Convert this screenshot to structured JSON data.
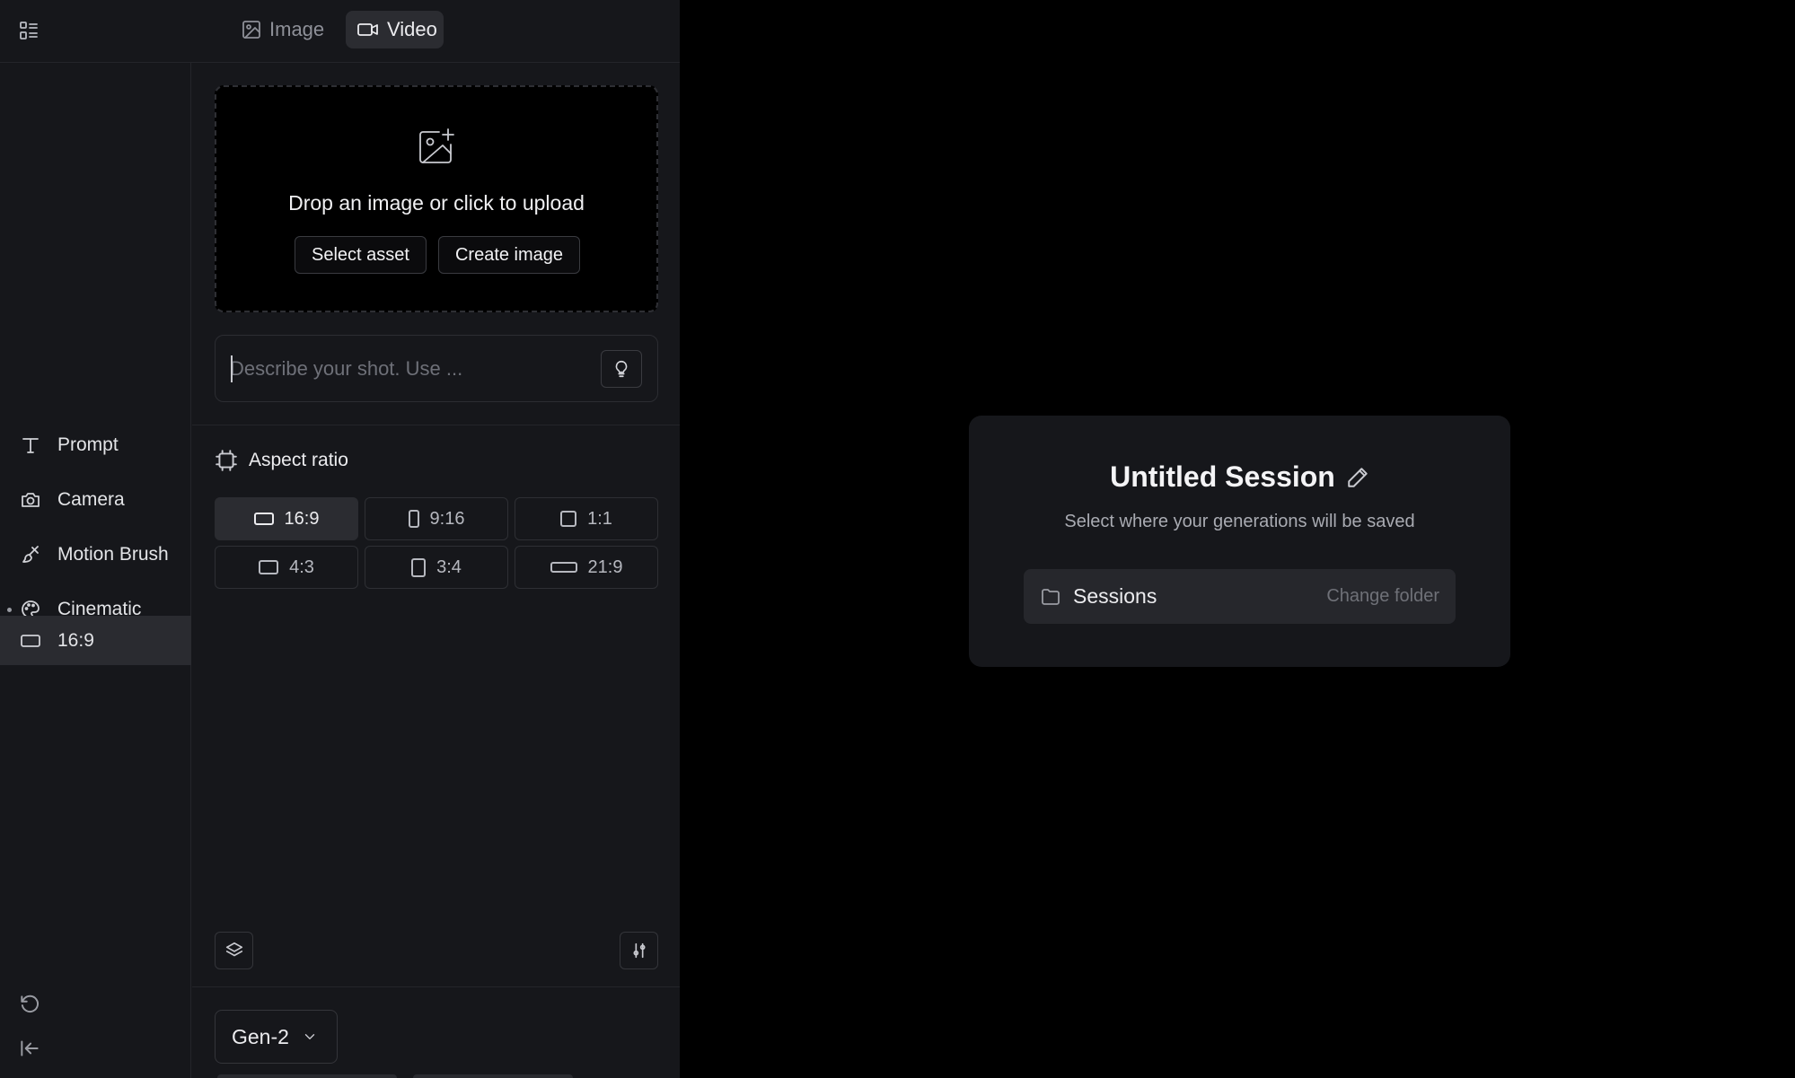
{
  "topbar": {
    "tabs": [
      {
        "label": "Image",
        "icon": "image-icon",
        "active": false
      },
      {
        "label": "Video",
        "icon": "video-icon",
        "active": true
      }
    ]
  },
  "sidebar": {
    "items": [
      {
        "label": "Prompt",
        "icon": "text-icon"
      },
      {
        "label": "Camera",
        "icon": "camera-icon"
      },
      {
        "label": "Motion Brush",
        "icon": "brush-icon"
      },
      {
        "label": "Cinematic",
        "icon": "palette-icon"
      },
      {
        "label": "16:9",
        "icon": "ratio-icon",
        "active": true
      }
    ]
  },
  "upload": {
    "text": "Drop an image or click to upload",
    "select_asset_label": "Select asset",
    "create_image_label": "Create image"
  },
  "prompt": {
    "placeholder": "Describe your shot. Use ..."
  },
  "aspect_ratio": {
    "title": "Aspect ratio",
    "options": [
      {
        "label": "16:9",
        "active": true
      },
      {
        "label": "9:16",
        "active": false
      },
      {
        "label": "1:1",
        "active": false
      },
      {
        "label": "4:3",
        "active": false
      },
      {
        "label": "3:4",
        "active": false
      },
      {
        "label": "21:9",
        "active": false
      }
    ]
  },
  "model": {
    "selected": "Gen-2"
  },
  "session": {
    "title": "Untitled Session",
    "subtitle": "Select where your generations will be saved",
    "folder_name": "Sessions",
    "change_folder_label": "Change folder"
  },
  "colors": {
    "background": "#000000",
    "panel": "#16171b",
    "active": "#2b2c31"
  }
}
